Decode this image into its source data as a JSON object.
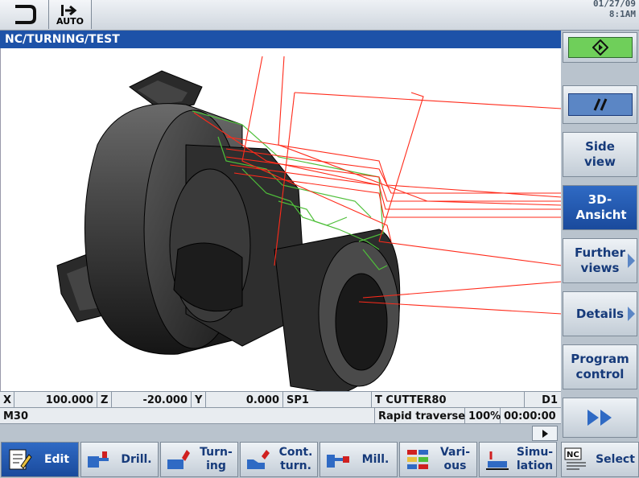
{
  "top": {
    "mode_label": "AUTO",
    "date": "01/27/09",
    "time": "8:1AM"
  },
  "title": "NC/TURNING/TEST",
  "status": {
    "x_label": "X",
    "x_value": "100.000",
    "z_label": "Z",
    "z_value": "-20.000",
    "y_label": "Y",
    "y_value": "0.000",
    "sp_label": "SP1",
    "tool": "T CUTTER80",
    "d": "D1",
    "mcode": "M30",
    "traverse": "Rapid traverse",
    "override": "100%",
    "runtime": "00:00:00"
  },
  "vertical_softkeys": [
    {
      "label": "",
      "icon": "cycle-start-icon"
    },
    {
      "label": "",
      "icon": "parallel-lines-icon"
    },
    {
      "label": "Side view"
    },
    {
      "label": "3D-Ansicht"
    },
    {
      "label": "Further views"
    },
    {
      "label": "Details"
    },
    {
      "label": "Program control"
    },
    {
      "label": "",
      "icon": "double-arrow-right-icon"
    }
  ],
  "horizontal_softkeys": [
    {
      "label": "Edit",
      "icon": "edit-icon"
    },
    {
      "label": "Drill.",
      "icon": "drill-icon"
    },
    {
      "label": "Turn-ing",
      "icon": "turning-icon"
    },
    {
      "label": "Cont. turn.",
      "icon": "contour-turning-icon"
    },
    {
      "label": "Mill.",
      "icon": "mill-icon"
    },
    {
      "label": "Vari-ous",
      "icon": "various-icon"
    },
    {
      "label": "Simu-lation",
      "icon": "simulation-icon"
    },
    {
      "label": "Select",
      "icon": "nc-select-icon"
    }
  ],
  "colors": {
    "title_bg": "#1d52a8",
    "active_softkey": "#1a4a9c",
    "start_green": "#6fcf5a",
    "toolpath_red": "#ff2a1a",
    "contour_green": "#4fbf3a"
  }
}
